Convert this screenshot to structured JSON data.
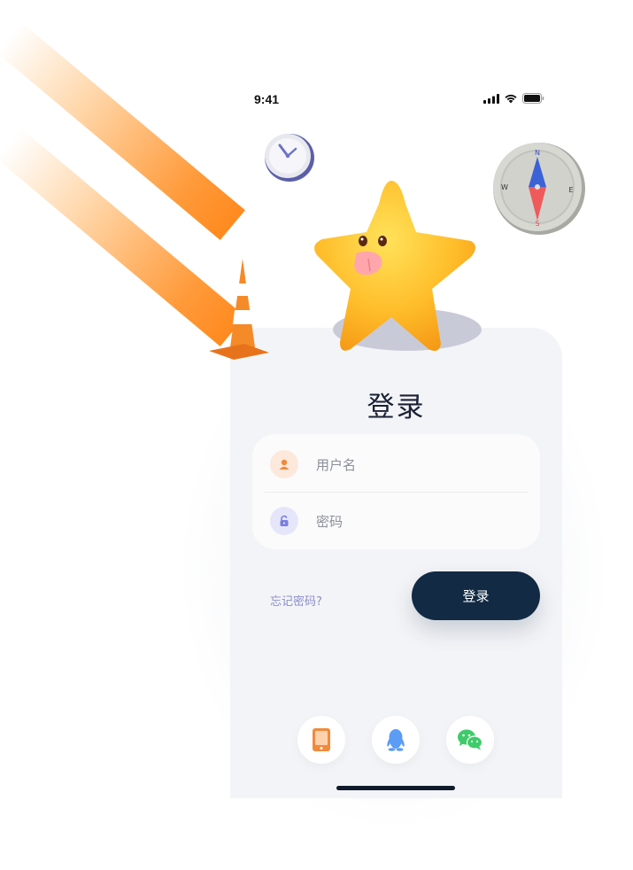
{
  "status_bar": {
    "time": "9:41"
  },
  "login": {
    "title": "登录",
    "username_placeholder": "用户名",
    "password_placeholder": "密码",
    "forgot_password": "忘记密码?",
    "submit_label": "登录"
  },
  "social_logins": [
    {
      "name": "phone",
      "icon": "phone-icon",
      "color": "#f28a3c"
    },
    {
      "name": "qq",
      "icon": "qq-penguin-icon",
      "color": "#5b9cf5"
    },
    {
      "name": "wechat",
      "icon": "wechat-icon",
      "color": "#3fcb6a"
    }
  ],
  "colors": {
    "primary_dark": "#122a44",
    "accent_orange": "#ff8a1f",
    "card_bg": "#f3f4f7",
    "link": "#8a8fc4"
  }
}
